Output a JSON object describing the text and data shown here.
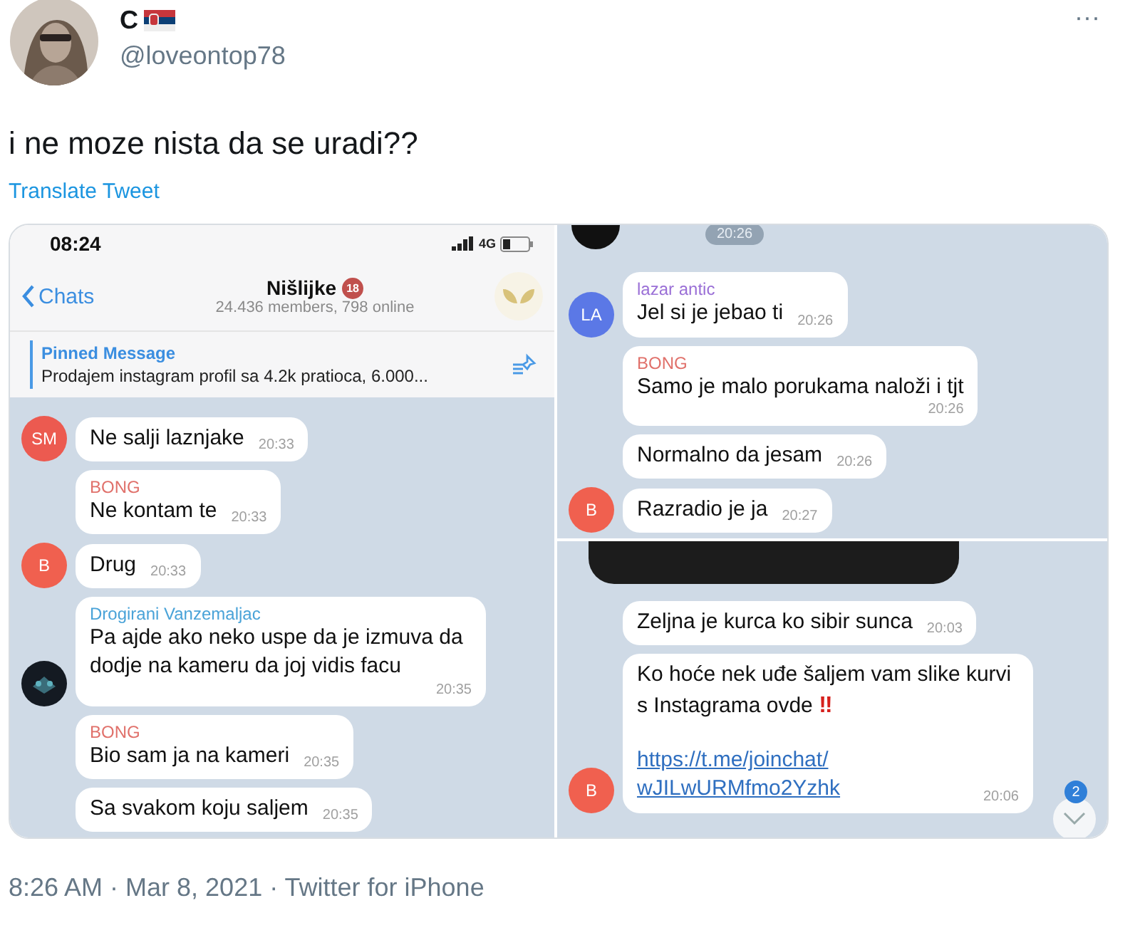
{
  "tweet": {
    "name": "C",
    "handle": "@loveontop78",
    "text": "i ne moze nista da se uradi??",
    "translate": "Translate Tweet",
    "more": "···",
    "footer": "8:26 AM · Mar 8, 2021 · Twitter for iPhone"
  },
  "left_screen": {
    "status_time": "08:24",
    "network": "4G",
    "back": "Chats",
    "title": "Nišlijke",
    "badge": "18",
    "subtitle": "24.436 members, 798 online",
    "pinned_label": "Pinned Message",
    "pinned_text": "Prodajem instagram profil sa 4.2k pratioca, 6.000...",
    "messages": [
      {
        "text": "Ne salji laznjake",
        "time": "20:33",
        "avatar": {
          "initials": "SM",
          "color": "#ec5a50"
        }
      },
      {
        "sender": "BONG",
        "color": "#e0706a",
        "text": "Ne kontam te",
        "time": "20:33"
      },
      {
        "text": "Drug",
        "time": "20:33",
        "avatar": {
          "initials": "B",
          "color": "#f0604f"
        }
      },
      {
        "sender": "Drogirani Vanzemaljac",
        "color": "#4aa3d8",
        "text": "Pa ajde ako neko uspe da je izmuva da dodje na kameru da joj vidis facu",
        "time": "20:35",
        "time_below": true
      },
      {
        "sender": "BONG",
        "color": "#e0706a",
        "text": "Bio sam ja na kameri",
        "time": "20:35"
      },
      {
        "text": "Sa svakom koju saljem",
        "time": "20:35"
      }
    ]
  },
  "right_top": {
    "top_chip": "20:26",
    "messages": [
      {
        "sender": "lazar antic",
        "color": "#9a6fd6",
        "text": "Jel si je jebao ti",
        "time": "20:26",
        "avatar": {
          "initials": "LA",
          "color": "#5b78e6"
        }
      },
      {
        "sender": "BONG",
        "color": "#e0706a",
        "text": "Samo je malo porukama naloži i tjt",
        "time": "20:26",
        "time_below": true
      },
      {
        "text": "Normalno da jesam",
        "time": "20:26"
      },
      {
        "text": "Razradio je ja",
        "time": "20:27",
        "avatar": {
          "initials": "B",
          "color": "#f0604f"
        }
      }
    ]
  },
  "right_bottom": {
    "messages": [
      {
        "text": "Zeljna je kurca ko sibir sunca",
        "time": "20:03"
      },
      {
        "text": "Ko hoće nek uđe šaljem vam slike kurvi s Instagrama ovde",
        "emoji": "‼",
        "link": "https://t.me/joinchat/\nwJILwURMfmo2Yzhk",
        "time": "20:06",
        "time_below": true,
        "avatar": {
          "initials": "B",
          "color": "#f0604f"
        }
      }
    ],
    "unread": "2"
  }
}
